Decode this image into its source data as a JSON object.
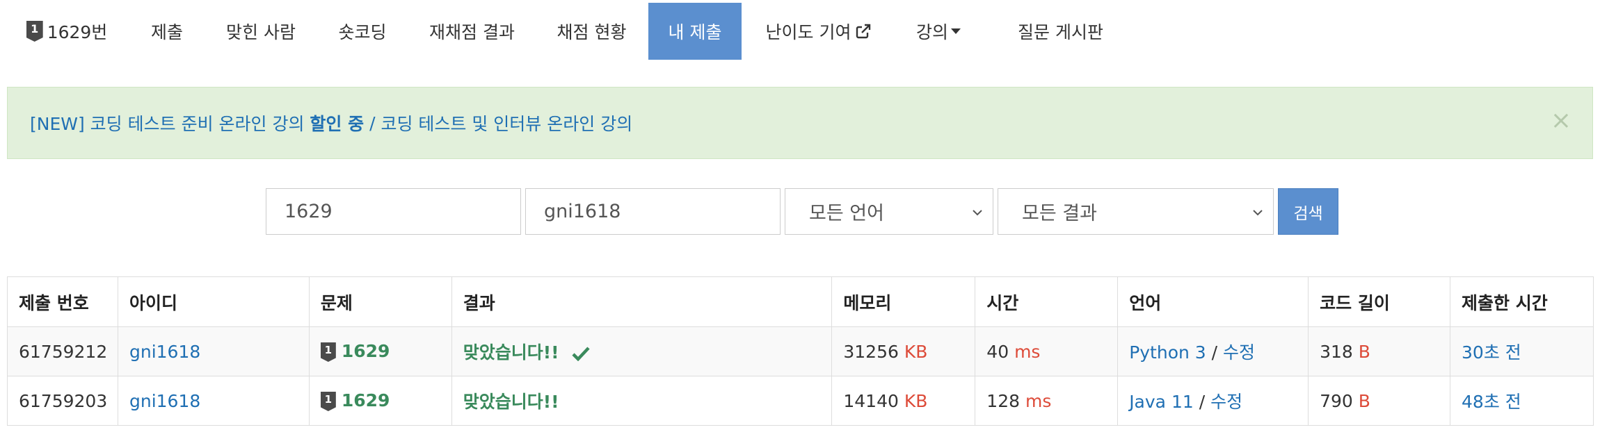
{
  "nav": {
    "problem_tier": "1",
    "problem_label": "1629번",
    "items": [
      "제출",
      "맞힌 사람",
      "숏코딩",
      "재채점 결과",
      "채점 현황",
      "내 제출",
      "난이도 기여",
      "강의",
      "질문 게시판"
    ],
    "active_index": 5
  },
  "alert": {
    "part1": "[NEW] 코딩 테스트 준비 온라인 강의 ",
    "part2": "할인 중",
    "part3": " / ",
    "part4": "코딩 테스트 및 인터뷰 온라인 강의",
    "close": "×"
  },
  "search": {
    "problem_value": "1629",
    "user_value": "gni1618",
    "language_selected": "모든 언어",
    "result_selected": "모든 결과",
    "button_label": "검색"
  },
  "table": {
    "headers": [
      "제출 번호",
      "아이디",
      "문제",
      "결과",
      "메모리",
      "시간",
      "언어",
      "코드 길이",
      "제출한 시간"
    ],
    "rows": [
      {
        "id": "61759212",
        "user": "gni1618",
        "tier": "1",
        "problem": "1629",
        "result": "맞았습니다!!",
        "memory": "31256",
        "memory_unit": "KB",
        "time": "40",
        "time_unit": "ms",
        "language": "Python 3",
        "sep": " / ",
        "edit": "수정",
        "code_length": "318",
        "code_unit": "B",
        "submitted": "30초 전",
        "check": true
      },
      {
        "id": "61759203",
        "user": "gni1618",
        "tier": "1",
        "problem": "1629",
        "result": "맞았습니다!!",
        "memory": "14140",
        "memory_unit": "KB",
        "time": "128",
        "time_unit": "ms",
        "language": "Java 11",
        "sep": " / ",
        "edit": "수정",
        "code_length": "790",
        "code_unit": "B",
        "submitted": "48초 전",
        "check": false
      }
    ]
  },
  "colors": {
    "accent": "#5b8fcf",
    "link": "#1f6fb3",
    "accepted": "#3a8a5c",
    "unit": "#dd4b39",
    "alert_bg": "#e2f0db"
  }
}
